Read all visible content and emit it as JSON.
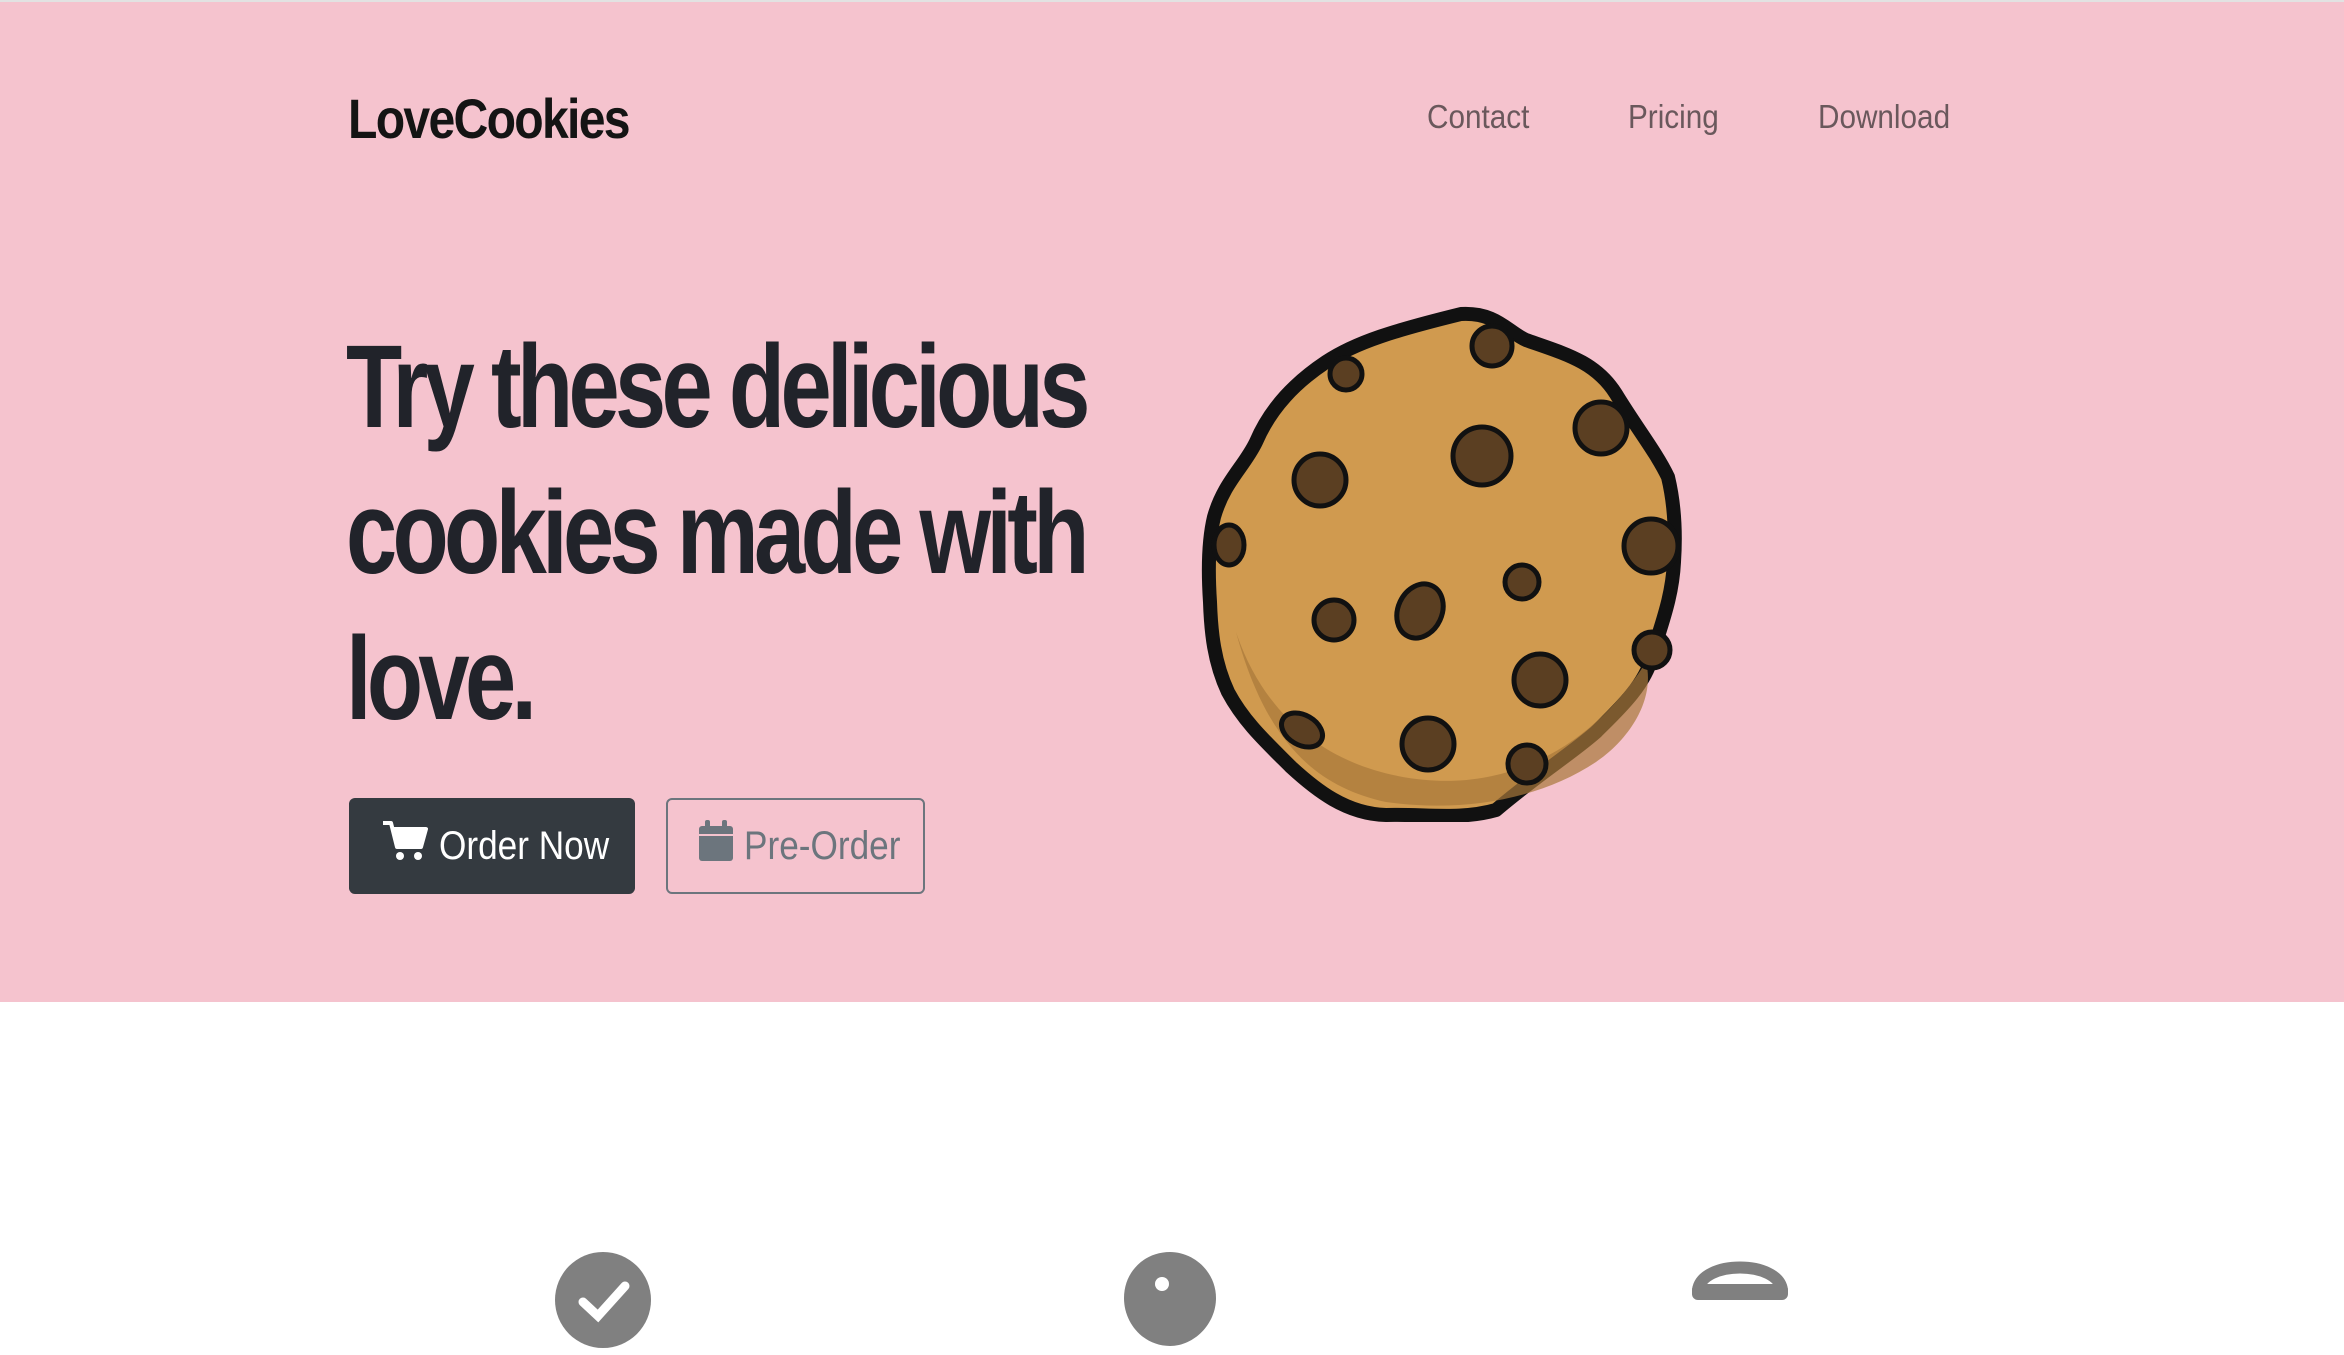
{
  "brand": {
    "name": "LoveCookies"
  },
  "nav": {
    "items": [
      "Contact",
      "Pricing",
      "Download"
    ]
  },
  "hero": {
    "headline_lines": [
      "Try these delicious",
      "cookies made with",
      "love."
    ],
    "order_button": {
      "label": "Order Now",
      "icon": "shopping-cart-icon"
    },
    "preorder_button": {
      "label": "Pre-Order",
      "icon": "calendar-icon"
    },
    "image": "cookie-illustration"
  },
  "features": {
    "icons": [
      "check-circle-icon",
      "cookie-bite-icon",
      "cake-stand-icon"
    ]
  },
  "colors": {
    "hero_bg": "#f5c3ce",
    "dark": "#343a40",
    "outline": "#6c757d",
    "cookie": "#d09a4f",
    "chip": "#5b3f22"
  }
}
